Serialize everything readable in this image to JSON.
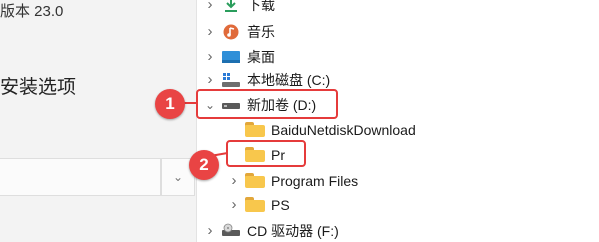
{
  "left_pane": {
    "version_text": "版本 23.0",
    "install_options": "安装选项",
    "dropdown_glyph": "⌄"
  },
  "tree": {
    "items": [
      {
        "label": "下载",
        "icon": "download-icon",
        "expanded": false
      },
      {
        "label": "音乐",
        "icon": "music-icon",
        "expanded": false
      },
      {
        "label": "桌面",
        "icon": "desktop-icon",
        "expanded": false
      },
      {
        "label": "本地磁盘 (C:)",
        "icon": "drive-icon",
        "expanded": false
      },
      {
        "label": "新加卷 (D:)",
        "icon": "drive-icon",
        "expanded": true
      },
      {
        "label": "BaiduNetdiskDownload",
        "icon": "folder-icon",
        "expanded": false
      },
      {
        "label": "Pr",
        "icon": "folder-icon",
        "expanded": false
      },
      {
        "label": "Program Files",
        "icon": "folder-icon",
        "expanded": false
      },
      {
        "label": "PS",
        "icon": "folder-icon",
        "expanded": false
      },
      {
        "label": "CD 驱动器 (F:)",
        "icon": "cd-drive-icon",
        "expanded": false
      }
    ]
  },
  "annotations": {
    "step1": "1",
    "step2": "2",
    "highlight_color": "#e53b3b"
  },
  "colors": {
    "folder": "#f8c74c",
    "accent_red": "#e94444"
  }
}
